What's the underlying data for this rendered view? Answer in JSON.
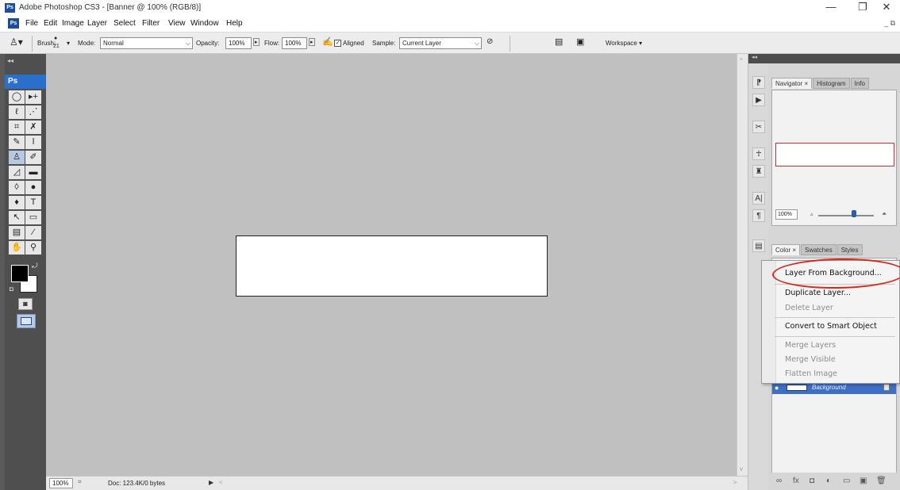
{
  "window": {
    "title": "Adobe Photoshop CS3 - [Banner @ 100% (RGB/8)]",
    "app_icon": "Ps",
    "controls": {
      "minimize": "—",
      "restore": "❐",
      "close": "✕"
    }
  },
  "menubar": {
    "items": [
      "File",
      "Edit",
      "Image",
      "Layer",
      "Select",
      "Filter",
      "View",
      "Window",
      "Help"
    ],
    "doc_controls": "_ ⧉"
  },
  "options_bar": {
    "tool_icon": "clone-stamp-icon",
    "brush_label": "Brush:",
    "brush_size": "21",
    "mode_label": "Mode:",
    "mode_value": "Normal",
    "opacity_label": "Opacity:",
    "opacity_value": "100%",
    "flow_label": "Flow:",
    "flow_value": "100%",
    "aligned_label": "Aligned",
    "aligned_checked": true,
    "sample_label": "Sample:",
    "sample_value": "Current Layer",
    "workspace_label": "Workspace ▾"
  },
  "toolbox": {
    "logo": "Ps",
    "collapse": "◂◂",
    "tools": [
      {
        "name": "marquee-tool",
        "glyph": "◯"
      },
      {
        "name": "move-tool",
        "glyph": "▸+"
      },
      {
        "name": "lasso-tool",
        "glyph": "ℓ"
      },
      {
        "name": "magic-wand-tool",
        "glyph": "⋰"
      },
      {
        "name": "crop-tool",
        "glyph": "⌗"
      },
      {
        "name": "slice-tool",
        "glyph": "✗"
      },
      {
        "name": "healing-brush-tool",
        "glyph": "✎"
      },
      {
        "name": "brush-tool",
        "glyph": "ǀ"
      },
      {
        "name": "clone-stamp-tool",
        "glyph": "♙"
      },
      {
        "name": "history-brush-tool",
        "glyph": "✐"
      },
      {
        "name": "eraser-tool",
        "glyph": "◿"
      },
      {
        "name": "gradient-tool",
        "glyph": "▬"
      },
      {
        "name": "blur-tool",
        "glyph": "◊"
      },
      {
        "name": "dodge-tool",
        "glyph": "●"
      },
      {
        "name": "pen-tool",
        "glyph": "♦"
      },
      {
        "name": "type-tool",
        "glyph": "T"
      },
      {
        "name": "path-select-tool",
        "glyph": "↖"
      },
      {
        "name": "shape-tool",
        "glyph": "▭"
      },
      {
        "name": "notes-tool",
        "glyph": "▤"
      },
      {
        "name": "eyedropper-tool",
        "glyph": "⁄"
      },
      {
        "name": "hand-tool",
        "glyph": "✋"
      },
      {
        "name": "zoom-tool",
        "glyph": "⚲"
      }
    ],
    "selected_tool": "clone-stamp-tool",
    "quickmask_glyph": "◙",
    "swap_glyph": "⤾",
    "default_glyph": "◘"
  },
  "status_bar": {
    "zoom": "100%",
    "doc_info": "Doc: 123.4K/0 bytes",
    "arrow": "▶",
    "scroll_left": "<",
    "scroll_right": ">"
  },
  "scrollbar": {
    "up": "^",
    "down": "v"
  },
  "dock": {
    "collapse": "◂◂",
    "buttons": [
      {
        "name": "history-brush-icon",
        "glyph": "⁋"
      },
      {
        "name": "actions-icon",
        "glyph": "▶"
      },
      {
        "name": "tool-presets-icon",
        "glyph": "✂"
      },
      {
        "name": "brushes-icon",
        "glyph": "☥"
      },
      {
        "name": "clone-source-icon",
        "glyph": "♜"
      },
      {
        "name": "character-icon",
        "glyph": "A|"
      },
      {
        "name": "paragraph-icon",
        "glyph": "¶"
      },
      {
        "name": "layer-comps-icon",
        "glyph": "▤"
      }
    ]
  },
  "panels": {
    "nav_tabs": [
      "Navigator ×",
      "Histogram",
      "Info"
    ],
    "nav_zoom": "100%",
    "nav_min": "▵",
    "nav_max": "⏶",
    "color_tabs": [
      "Color ×",
      "Swatches",
      "Styles"
    ],
    "layer_name": "Background",
    "layer_eye": "●",
    "footer_icons": [
      "∞",
      "fx",
      "◘",
      "◐",
      "▭",
      "▣",
      "🗑"
    ]
  },
  "context_menu": {
    "items": [
      {
        "label": "Layer From Background...",
        "enabled": true
      },
      {
        "label": "Duplicate Layer...",
        "enabled": true
      },
      {
        "label": "Delete Layer",
        "enabled": false
      },
      {
        "label": "Convert to Smart Object",
        "enabled": true
      },
      {
        "label": "Merge Layers",
        "enabled": false
      },
      {
        "label": "Merge Visible",
        "enabled": false
      },
      {
        "label": "Flatten Image",
        "enabled": false
      }
    ]
  },
  "colors": {
    "annotation": "#d8281c",
    "selection_blue": "#3e6fc6",
    "canvas_gray": "#c0c0c0"
  }
}
